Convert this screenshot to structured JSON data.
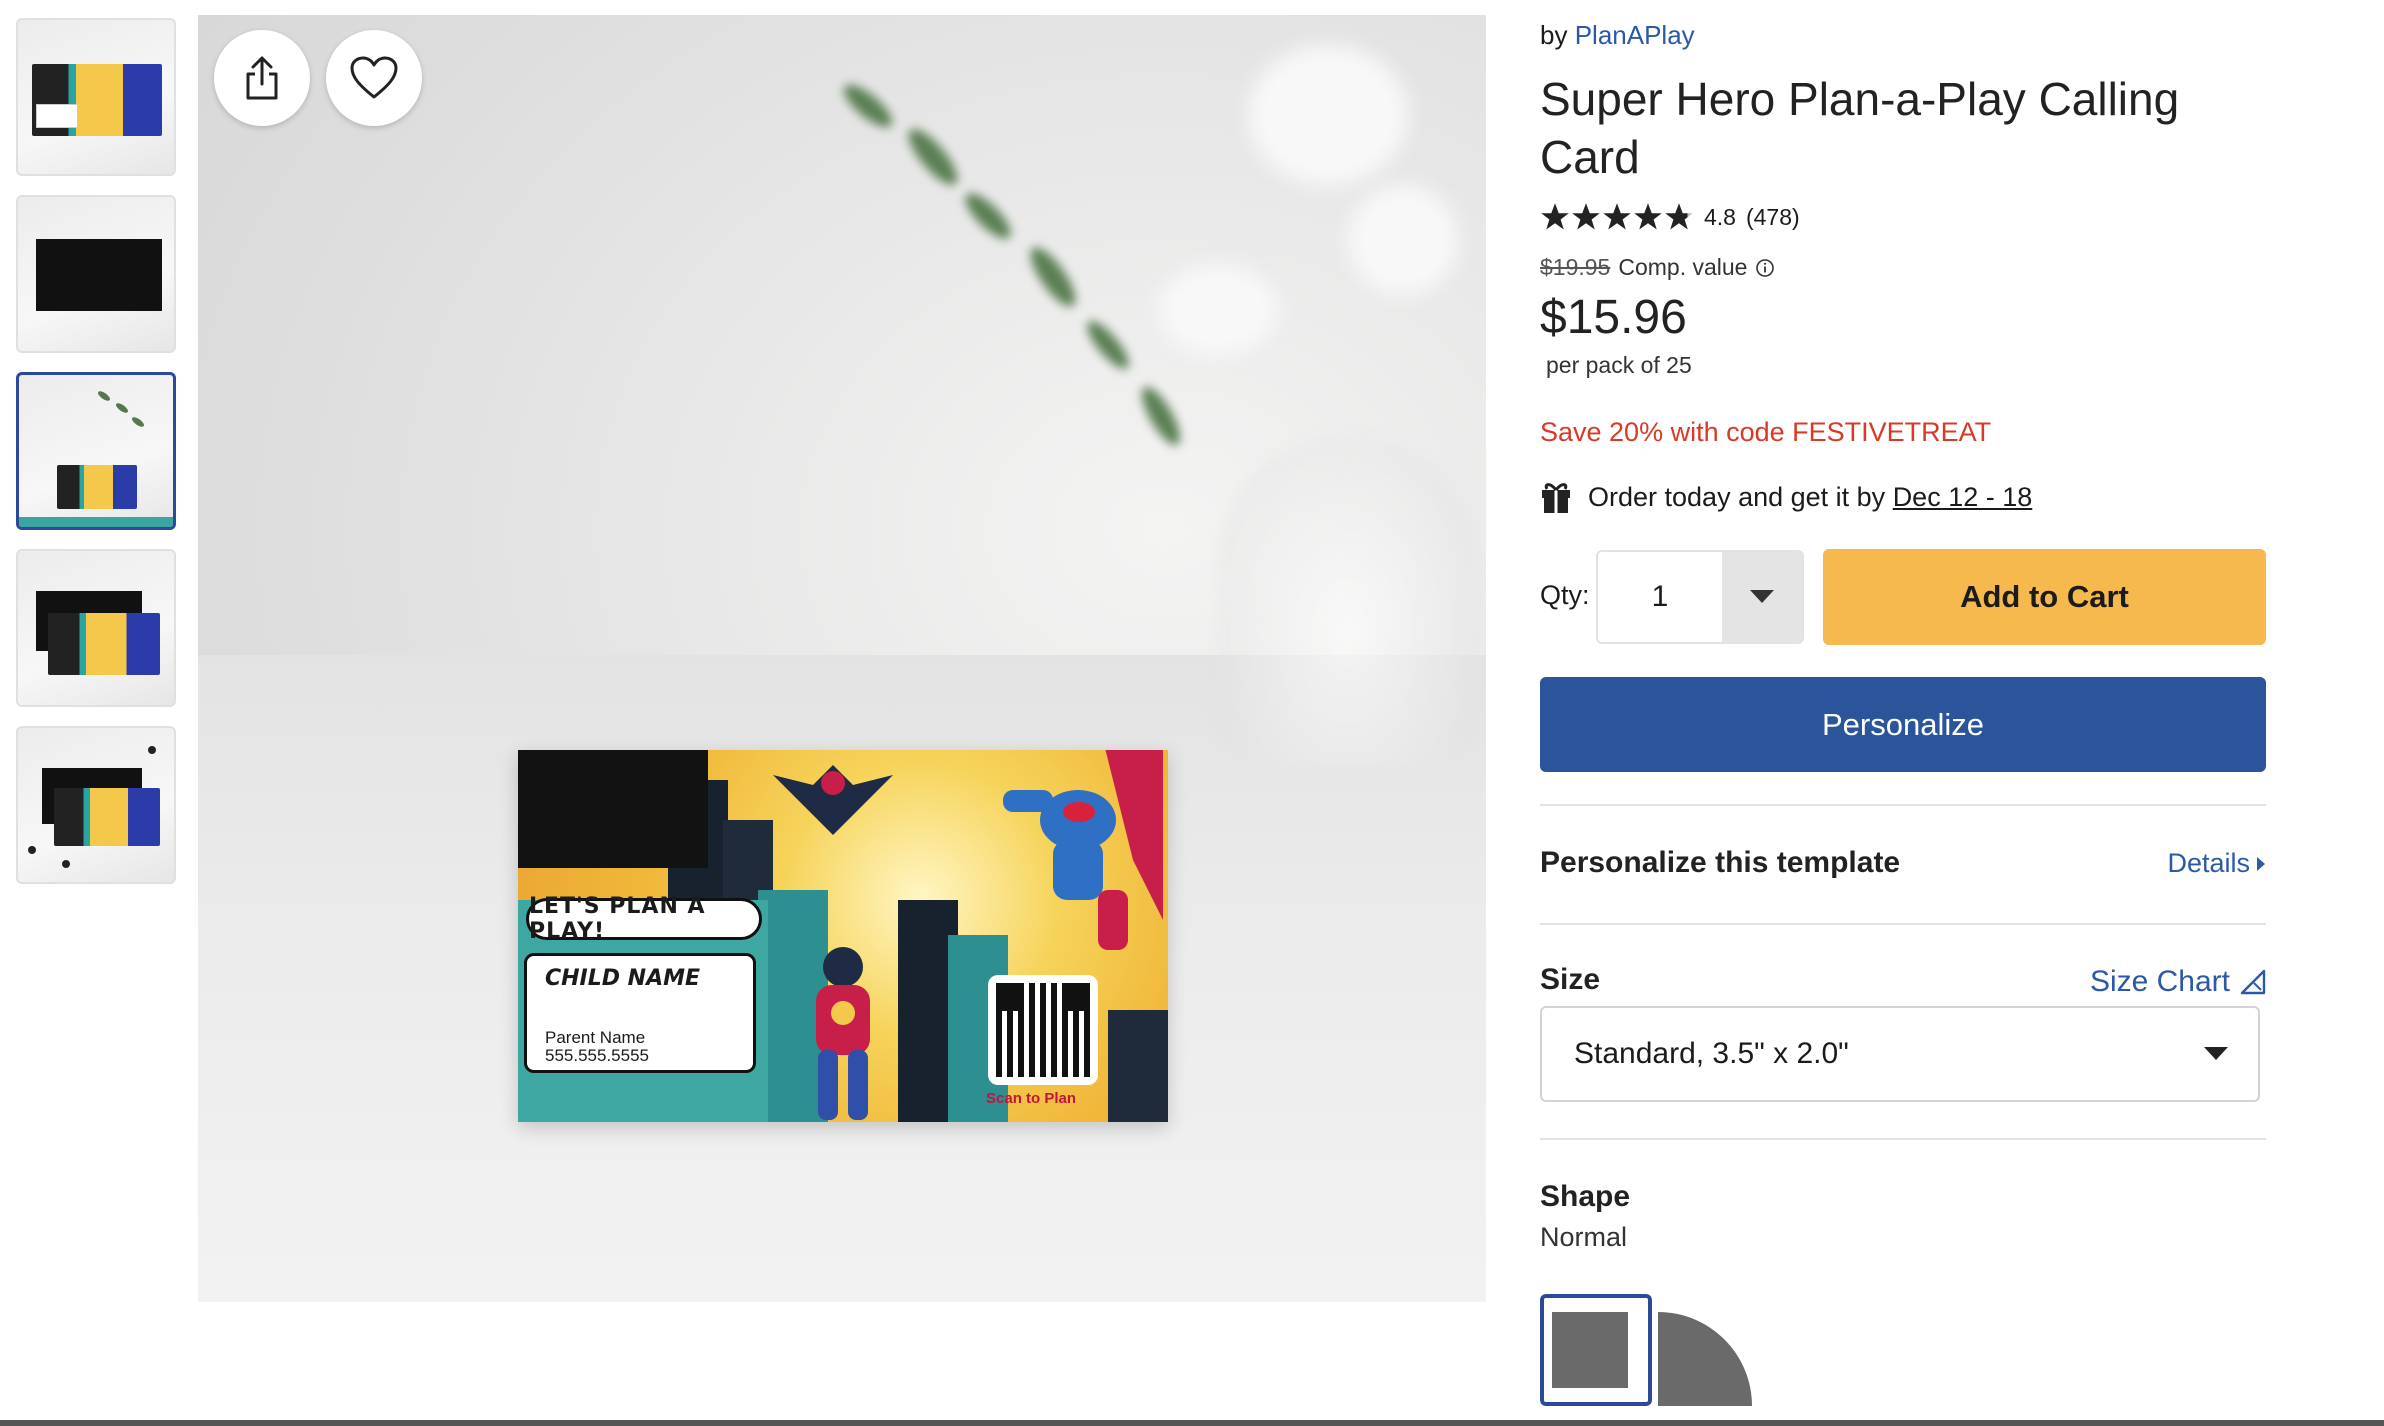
{
  "gallery": {
    "share_icon": "share-icon",
    "favorite_icon": "heart-icon",
    "thumbnails": [
      {
        "label": "Front with card preview"
      },
      {
        "label": "Back (black)"
      },
      {
        "label": "Card on table with plant",
        "selected": true
      },
      {
        "label": "Front and back stacked"
      },
      {
        "label": "Cards on marble with pins"
      }
    ]
  },
  "card": {
    "bubble_text": "LET'S PLAN A PLAY!",
    "child_name": "CHILD NAME",
    "parent_name": "Parent Name",
    "phone": "555.555.5555",
    "qr_caption": "Scan to Plan"
  },
  "product": {
    "by_prefix": "by",
    "brand": "PlanAPlay",
    "title": "Super Hero Plan-a-Play Calling Card",
    "rating": "4.8",
    "rating_stars": 4.8,
    "review_count": "(478)",
    "comp_price": "$19.95",
    "comp_label": "Comp. value",
    "price": "$15.96",
    "per_pack": "per pack of 25",
    "promo": "Save 20% with code FESTIVETREAT",
    "delivery_prefix": "Order today and get it by",
    "delivery_date": "Dec 12 - 18"
  },
  "purchase": {
    "qty_label": "Qty:",
    "qty_value": "1",
    "add_to_cart": "Add to Cart",
    "personalize": "Personalize"
  },
  "template": {
    "heading": "Personalize this template",
    "details_link": "Details"
  },
  "size": {
    "heading": "Size",
    "chart_link": "Size Chart",
    "selected": "Standard, 3.5\" x 2.0\""
  },
  "shape": {
    "heading": "Shape",
    "selected": "Normal"
  },
  "colors": {
    "brand_blue": "#2c549a",
    "cart_yellow": "#f5b94d",
    "promo_red": "#d83a25",
    "link_blue": "#2b59a8"
  }
}
